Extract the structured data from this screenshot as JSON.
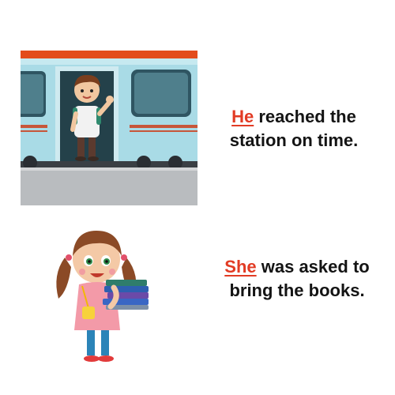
{
  "sentences": [
    {
      "pronoun": "He",
      "line1_rest": " reached the",
      "line2": "station on time."
    },
    {
      "pronoun": "She",
      "line1_rest": " was asked to",
      "line2": "bring the books."
    }
  ],
  "colors": {
    "pronoun": "#e23b24",
    "text": "#141414",
    "train_body": "#a9dbe6",
    "train_roof": "#e34c1c",
    "platform": "#b9bcbf"
  },
  "illustrations": [
    "boy-waving-in-train-door",
    "girl-carrying-books"
  ]
}
